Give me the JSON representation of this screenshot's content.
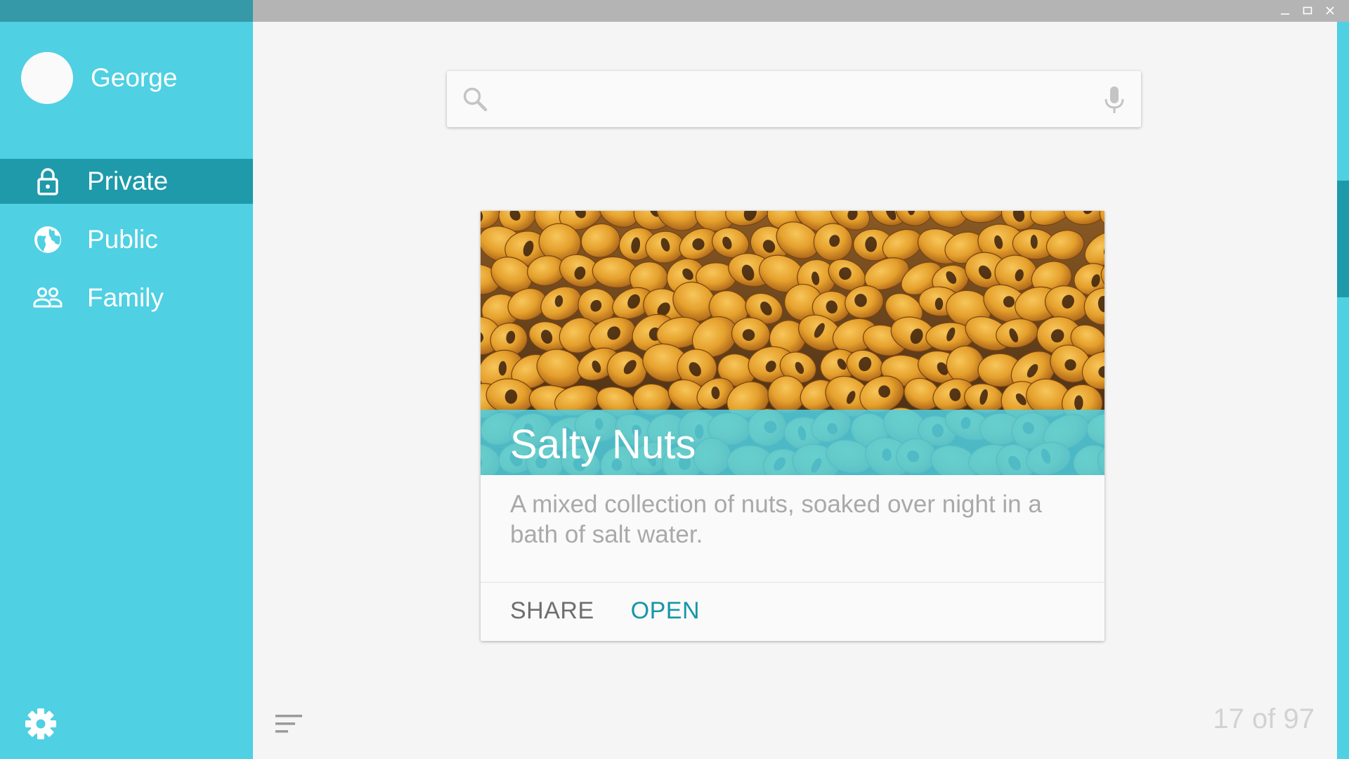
{
  "window": {
    "controls": [
      {
        "name": "minimize-icon"
      },
      {
        "name": "maximize-icon"
      },
      {
        "name": "close-icon"
      }
    ]
  },
  "sidebar": {
    "profile": {
      "name": "George"
    },
    "items": [
      {
        "label": "Private",
        "icon": "lock-icon",
        "active": true
      },
      {
        "label": "Public",
        "icon": "globe-icon",
        "active": false
      },
      {
        "label": "Family",
        "icon": "people-icon",
        "active": false
      }
    ],
    "settings_icon": "gear-icon"
  },
  "search": {
    "placeholder": "",
    "value": ""
  },
  "card": {
    "title": "Salty Nuts",
    "description": "A mixed collection of nuts, soaked over night in a bath of salt water.",
    "actions": {
      "share": "SHARE",
      "open": "OPEN"
    }
  },
  "footer": {
    "counter": "17 of 97",
    "sort_icon": "sort-icon"
  },
  "colors": {
    "accent": "#4fd0e3",
    "accent_dark": "#1e9aaa",
    "titlebar_left": "#3599a8",
    "open_text": "#1696a8"
  }
}
